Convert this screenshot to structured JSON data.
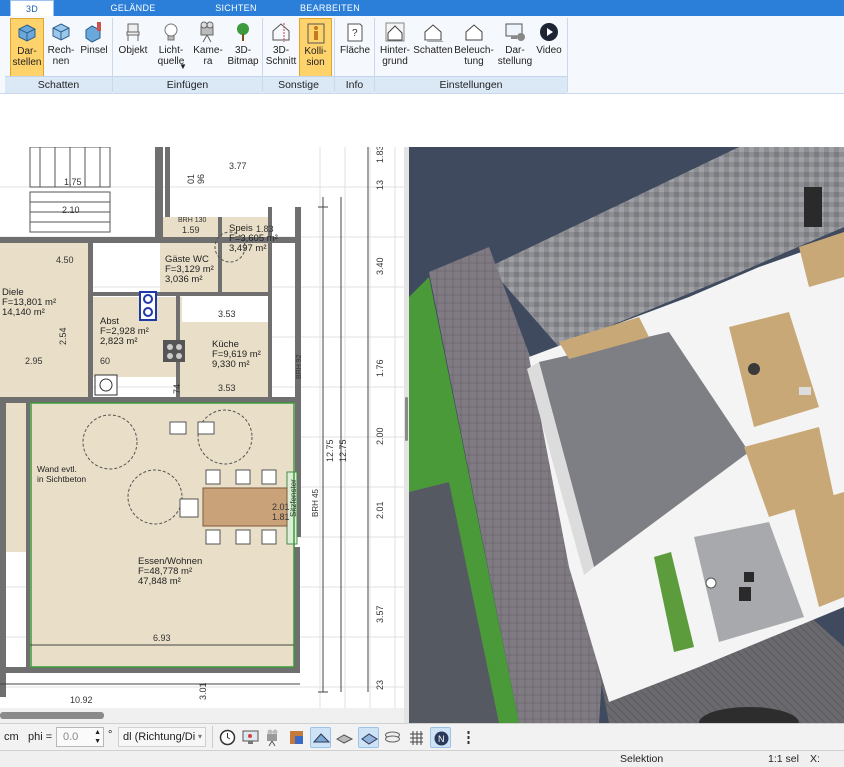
{
  "tabs": [
    {
      "label": "3D"
    },
    {
      "label": "GELÄNDE"
    },
    {
      "label": "SICHTEN"
    },
    {
      "label": "BEARBEITEN"
    }
  ],
  "ribbon": {
    "buttons": {
      "darstellen": "Dar-\nstellen",
      "rechnen": "Rech-\nnen",
      "pinsel": "Pinsel",
      "objekt": "Objekt",
      "lichtquelle": "Licht-\nquelle",
      "kamera": "Kame-\nra",
      "bitmap": "3D-\nBitmap",
      "schnitt": "3D-\nSchnitt",
      "kollision": "Kolli-\nsion",
      "flaeche": "Fläche",
      "hintergrund": "Hinter-\ngrund",
      "schatten": "Schatten",
      "beleuchtung": "Beleuch-\ntung",
      "darstellung": "Dar-\nstellung",
      "video": "Video"
    },
    "groups": {
      "schatten": "Schatten",
      "einfuegen": "Einfügen",
      "sonstige": "Sonstige",
      "info": "Info",
      "einstellungen": "Einstellungen"
    }
  },
  "plan": {
    "rooms": {
      "diele_name": "Diele",
      "diele_f": "F=13,801 m²",
      "diele_v": "14,140 m²",
      "abst_name": "Abst",
      "abst_f": "F=2,928 m²",
      "abst_v": "2,823 m²",
      "gaeste_name": "Gäste WC",
      "gaeste_f": "F=3,129 m²",
      "gaeste_v": "3,036 m²",
      "speis_name": "Speis",
      "speis_f": "F=3,605 m²",
      "speis_v": "3,497 m²",
      "kueche_name": "Küche",
      "kueche_f": "F=9,619 m²",
      "kueche_v": "9,330 m²",
      "essen_name": "Essen/Wohnen",
      "essen_f": "F=48,778 m²",
      "essen_v": "47,848 m²"
    },
    "notes": {
      "wand_line1": "Wand evtl.",
      "wand_line2": "in Sichtbeton",
      "sitzfenster": "Sitzfenster",
      "brh45": "BRH 45",
      "brh92": "BRH 92",
      "brh130": "BRH 130"
    },
    "dims": {
      "d377": "3.77",
      "d175": "1.75",
      "d210": "2.10",
      "d450": "4.50",
      "d295": "2.95",
      "d353a": "3.53",
      "d353b": "3.53",
      "d693": "6.93",
      "d1092": "10.92",
      "d183": "1.83",
      "d340": "3.40",
      "d176": "1.76",
      "d200": "2.00",
      "d201": "2.01",
      "d357": "3.57",
      "d1275a": "12.75",
      "d1275b": "12.75",
      "d159": "1.59",
      "d183b": "1.83",
      "d201b": "2.01",
      "d181": "1.81",
      "d254": "2.54",
      "d605": "60",
      "d74": "74",
      "d310": "3.01",
      "d23": "23",
      "d13": "13",
      "d96": "96",
      "d01": "01"
    }
  },
  "bottombar": {
    "unit": "cm",
    "phi_label": "phi =",
    "phi_value": "0.0",
    "degree": "°",
    "mode_select": "dl (Richtung/Di"
  },
  "status": {
    "mode": "Selektion",
    "selection": "1:1 sel",
    "x_label": "X:"
  },
  "colors": {
    "tab_blue": "#2b7fd8",
    "active_button": "#ffd36b",
    "group_label": "#dbe8f6",
    "floor_beige": "#e9dfc8",
    "wall_dark": "#6f6f6f",
    "lawn_green": "#4a9a3a",
    "paving": "#8e8f95"
  }
}
